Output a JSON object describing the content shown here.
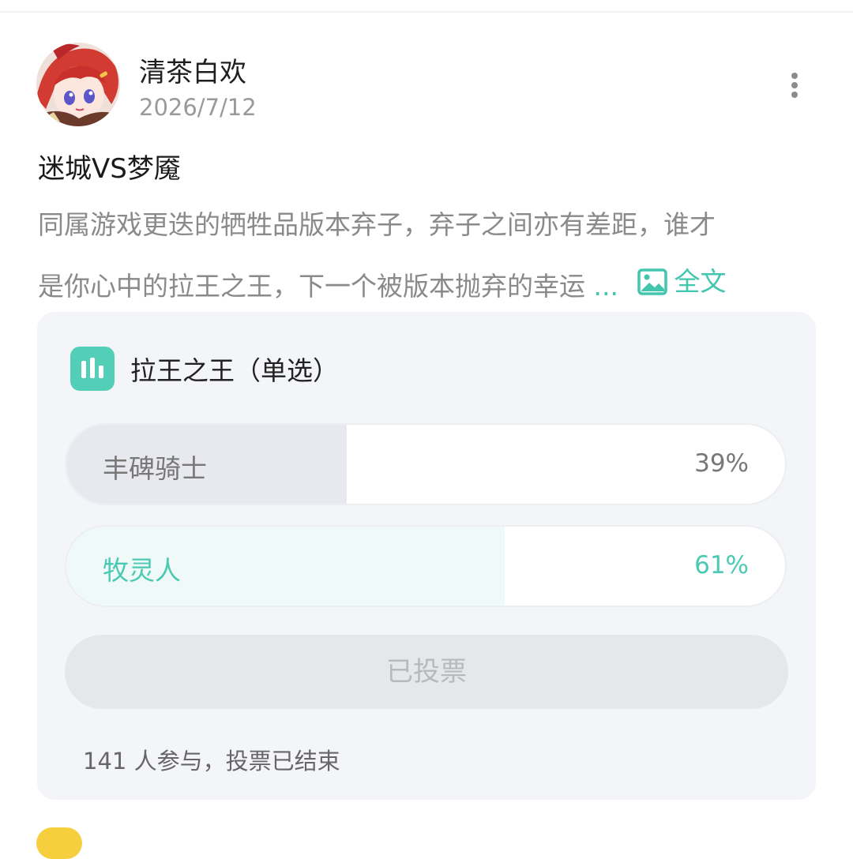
{
  "author": {
    "name": "清茶白欢",
    "date": "2026/7/12",
    "avatar_icon": "anime-character-avatar-icon",
    "more_icon": "more-vertical-icon"
  },
  "post": {
    "title": "迷城VS梦魇",
    "body_line1": "同属游戏更迭的牺牲品版本弃子，弃子之间亦有差距，谁才",
    "body_line2": "是你心中的拉王之王，下一个被版本抛弃的幸运",
    "ellipsis": "...",
    "fulltext_label": "全文",
    "fulltext_icon": "image-icon"
  },
  "poll": {
    "icon": "bar-chart-icon",
    "title": "拉王之王（单选）",
    "options": [
      {
        "label": "丰碑骑士",
        "percent_text": "39%",
        "percent": 39,
        "selected": false
      },
      {
        "label": "牧灵人",
        "percent_text": "61%",
        "percent": 61,
        "selected": true
      }
    ],
    "vote_button": "已投票",
    "footer": "141 人参与，投票已结束"
  },
  "colors": {
    "accent": "#43c6ad",
    "poll_background": "#f4f5f8",
    "text_secondary": "#8a8a8a"
  }
}
